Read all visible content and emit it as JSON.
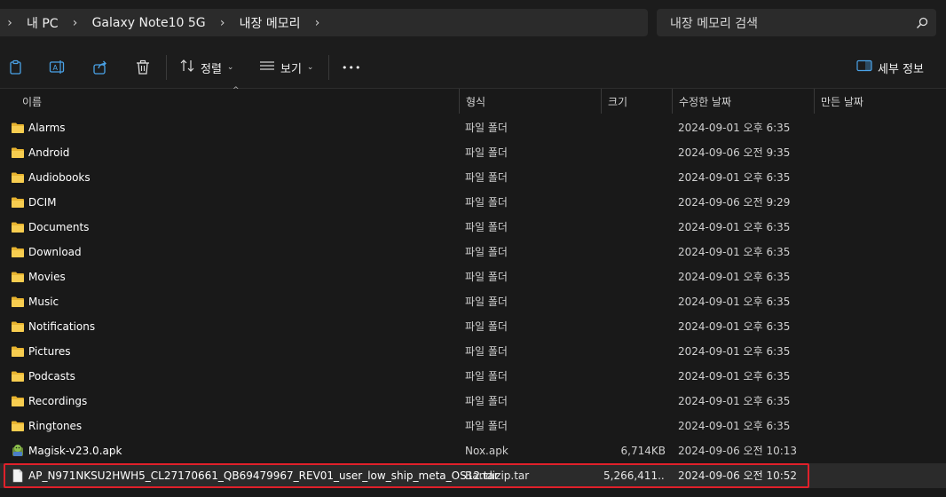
{
  "breadcrumb": {
    "items": [
      {
        "label": "내 PC"
      },
      {
        "label": "Galaxy Note10 5G"
      },
      {
        "label": "내장 메모리"
      }
    ]
  },
  "search": {
    "placeholder": "내장 메모리 검색"
  },
  "toolbar": {
    "sort_label": "정렬",
    "view_label": "보기",
    "more_label": "•••",
    "details_label": "세부 정보"
  },
  "columns": {
    "name": "이름",
    "type": "형식",
    "size": "크기",
    "modified": "수정한 날짜",
    "created": "만든 날짜"
  },
  "files": [
    {
      "name": "Alarms",
      "type": "파일 폴더",
      "size": "",
      "modified": "2024-09-01 오후 6:35",
      "icon": "folder-icon"
    },
    {
      "name": "Android",
      "type": "파일 폴더",
      "size": "",
      "modified": "2024-09-06 오전 9:35",
      "icon": "folder-icon"
    },
    {
      "name": "Audiobooks",
      "type": "파일 폴더",
      "size": "",
      "modified": "2024-09-01 오후 6:35",
      "icon": "folder-icon"
    },
    {
      "name": "DCIM",
      "type": "파일 폴더",
      "size": "",
      "modified": "2024-09-06 오전 9:29",
      "icon": "folder-icon"
    },
    {
      "name": "Documents",
      "type": "파일 폴더",
      "size": "",
      "modified": "2024-09-01 오후 6:35",
      "icon": "folder-icon"
    },
    {
      "name": "Download",
      "type": "파일 폴더",
      "size": "",
      "modified": "2024-09-01 오후 6:35",
      "icon": "folder-icon"
    },
    {
      "name": "Movies",
      "type": "파일 폴더",
      "size": "",
      "modified": "2024-09-01 오후 6:35",
      "icon": "folder-icon"
    },
    {
      "name": "Music",
      "type": "파일 폴더",
      "size": "",
      "modified": "2024-09-01 오후 6:35",
      "icon": "folder-icon"
    },
    {
      "name": "Notifications",
      "type": "파일 폴더",
      "size": "",
      "modified": "2024-09-01 오후 6:35",
      "icon": "folder-icon"
    },
    {
      "name": "Pictures",
      "type": "파일 폴더",
      "size": "",
      "modified": "2024-09-01 오후 6:35",
      "icon": "folder-icon"
    },
    {
      "name": "Podcasts",
      "type": "파일 폴더",
      "size": "",
      "modified": "2024-09-01 오후 6:35",
      "icon": "folder-icon"
    },
    {
      "name": "Recordings",
      "type": "파일 폴더",
      "size": "",
      "modified": "2024-09-01 오후 6:35",
      "icon": "folder-icon"
    },
    {
      "name": "Ringtones",
      "type": "파일 폴더",
      "size": "",
      "modified": "2024-09-01 오후 6:35",
      "icon": "folder-icon"
    },
    {
      "name": "Magisk-v23.0.apk",
      "type": "Nox.apk",
      "size": "6,714KB",
      "modified": "2024-09-06 오전 10:13",
      "icon": "apk-icon"
    },
    {
      "name": "AP_N971NKSU2HWH5_CL27170661_QB69479967_REV01_user_low_ship_meta_OS12.tar",
      "type": "Bandizip.tar",
      "size": "5,266,411...",
      "modified": "2024-09-06 오전 10:52",
      "icon": "file-icon",
      "selected": true
    }
  ],
  "colors": {
    "background": "#191919",
    "folder": "#f4c542",
    "highlight_border": "#e0202a"
  }
}
